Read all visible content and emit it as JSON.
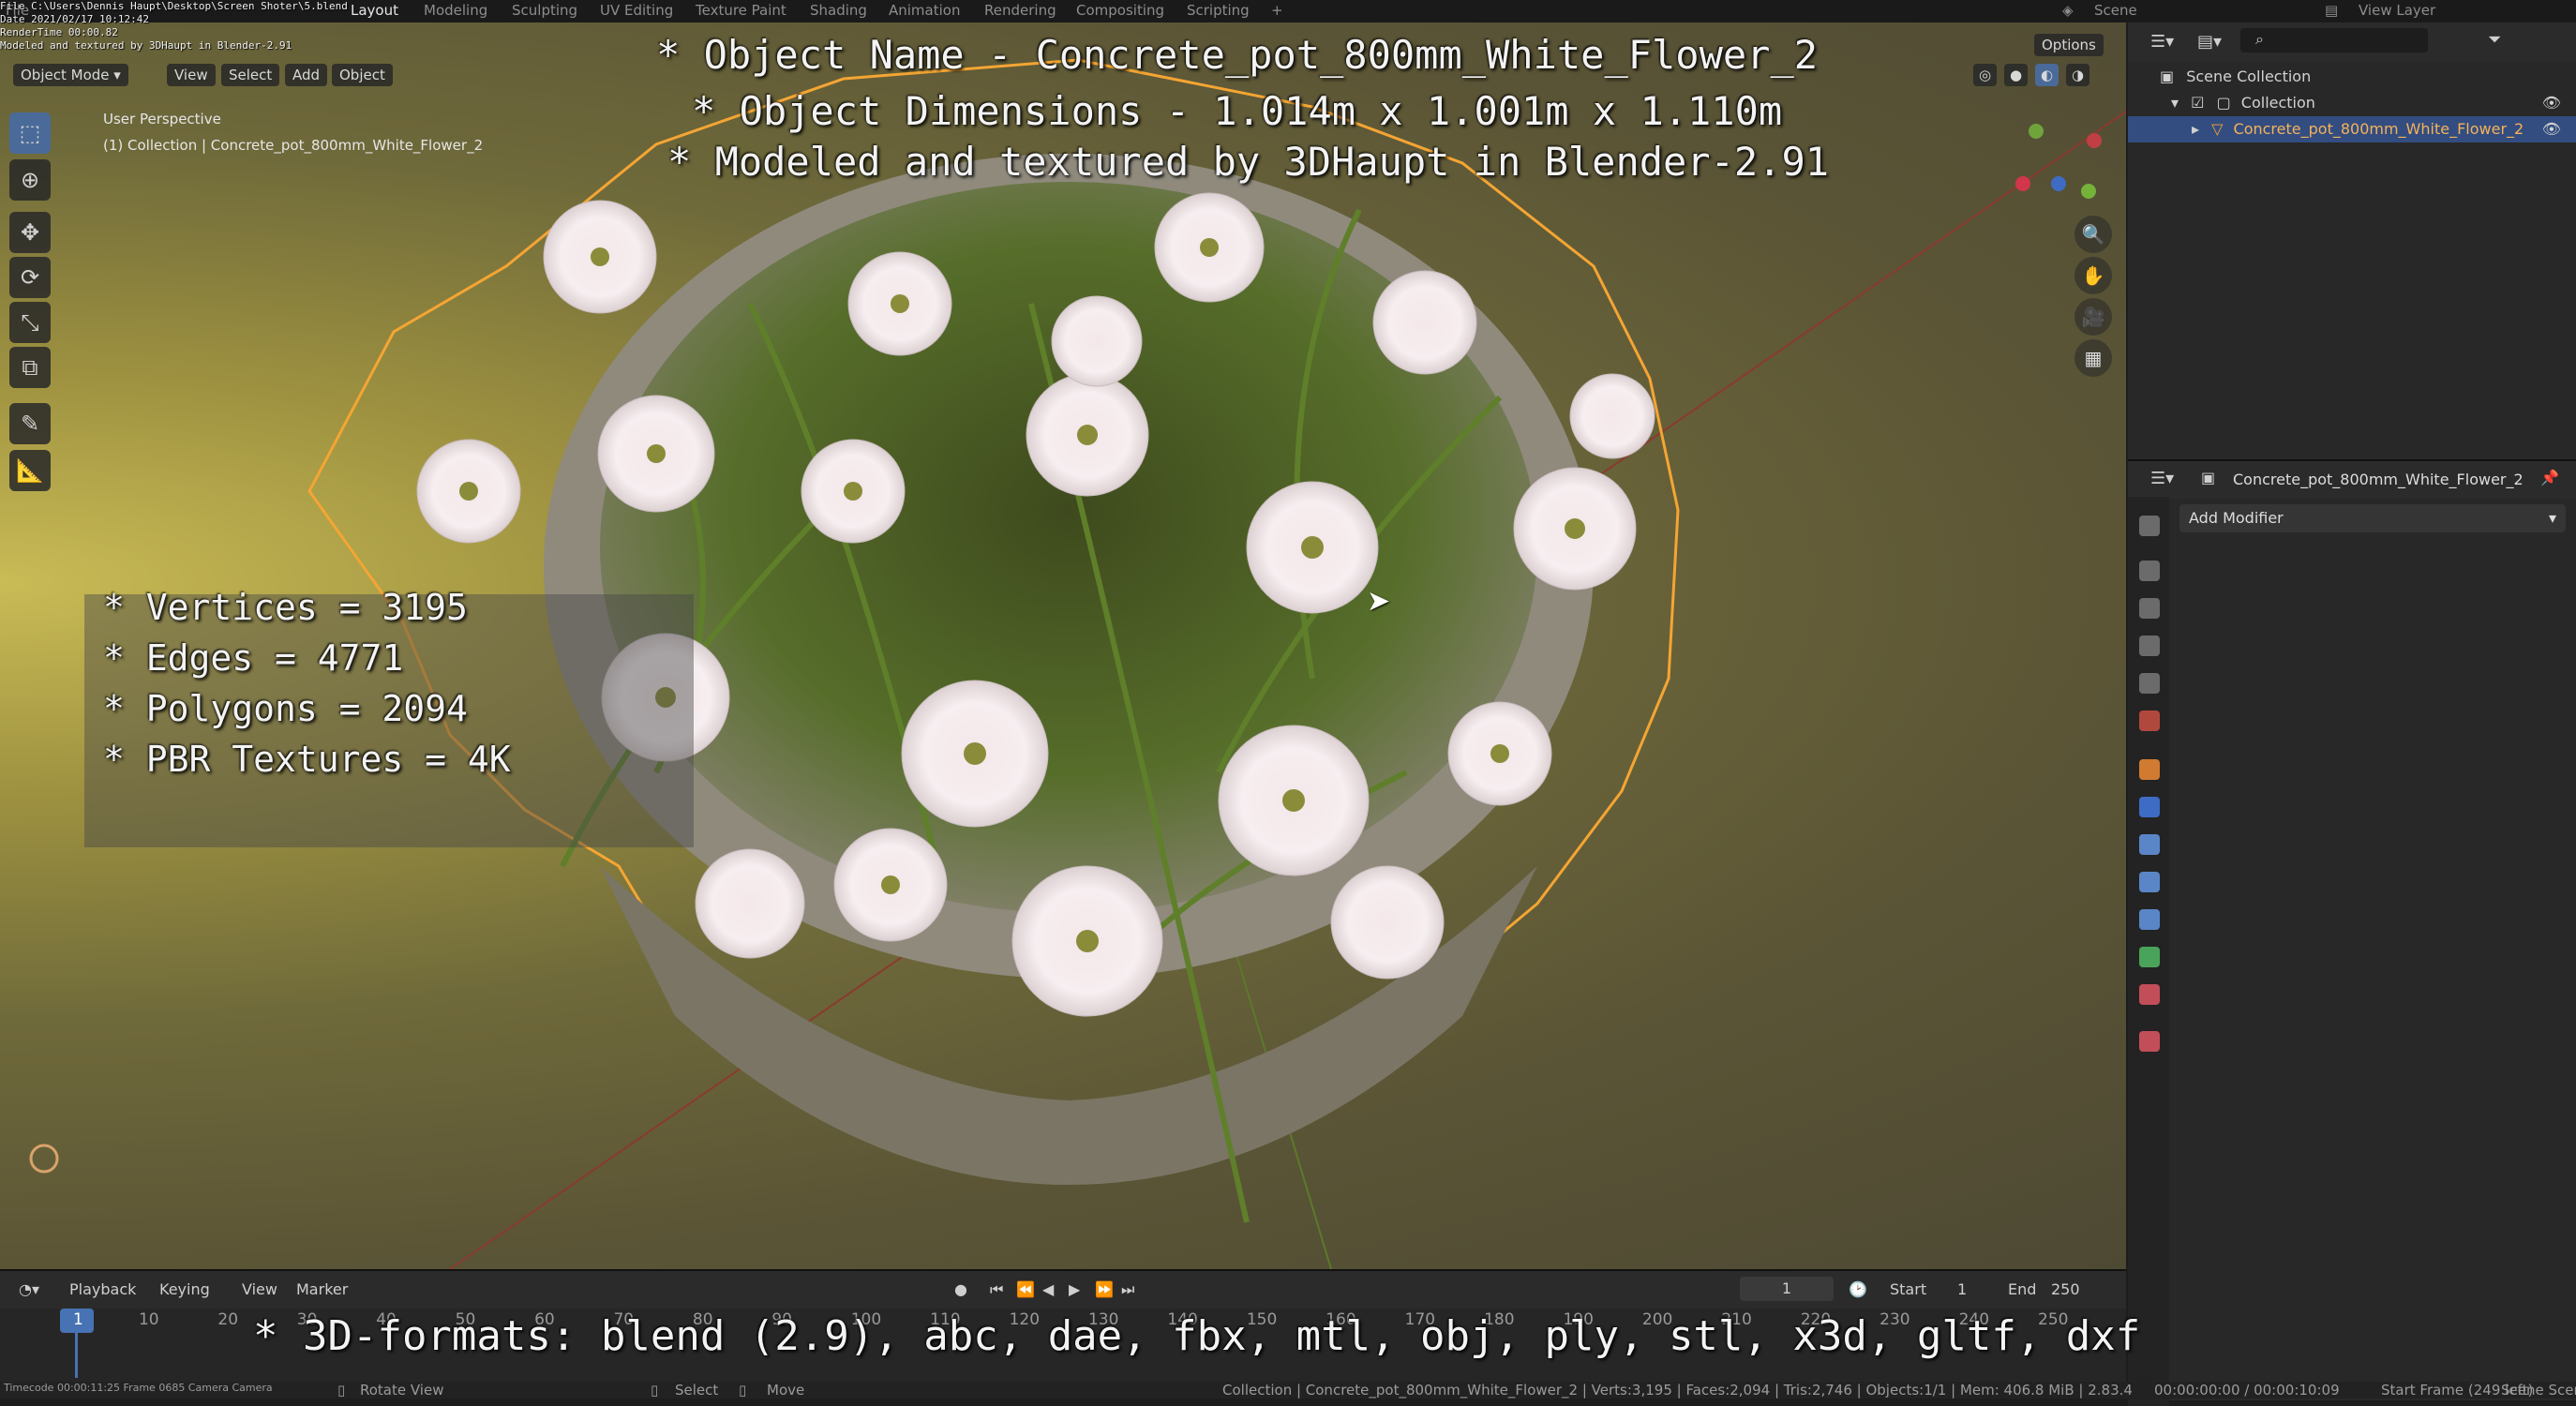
{
  "topbar": {
    "menu": "File",
    "workspaces": [
      "Layout",
      "Modeling",
      "Sculpting",
      "UV Editing",
      "Texture Paint",
      "Shading",
      "Animation",
      "Rendering",
      "Compositing",
      "Scripting"
    ],
    "scene_label": "Scene",
    "view_layer_label": "View Layer",
    "burnin": [
      "File C:\\Users\\Dennis Haupt\\Desktop\\Screen Shoter\\5.blend",
      "Date 2021/02/17 10:12:42",
      "RenderTime 00:00.82",
      "Modeled and textured by 3DHaupt in Blender-2.91"
    ]
  },
  "viewport": {
    "mode": "Object Mode",
    "menus": [
      "View",
      "Select",
      "Add",
      "Object"
    ],
    "perspective": "User Perspective",
    "collection_info": "(1) Collection | Concrete_pot_800mm_White_Flower_2",
    "options": "Options"
  },
  "overlay": {
    "title": "* Object Name - Concrete_pot_800mm_White_Flower_2",
    "dimensions": "* Object Dimensions -  1.014m x 1.001m x 1.110m",
    "credit": "* Modeled and textured by 3DHaupt in Blender-2.91",
    "stats": [
      "* Vertices = 3195",
      "* Edges = 4771",
      "* Polygons = 2094",
      "* PBR Textures = 4K"
    ],
    "formats": "* 3D-formats: blend (2.9), abc, dae, fbx, mtl, obj, ply, stl, x3d, gltf, dxf"
  },
  "outliner": {
    "scene_collection": "Scene Collection",
    "collection": "Collection",
    "object": "Concrete_pot_800mm_White_Flower_2"
  },
  "properties": {
    "object_name": "Concrete_pot_800mm_White_Flower_2",
    "add_modifier": "Add Modifier"
  },
  "timeline": {
    "menus": [
      "Playback",
      "Keying",
      "View",
      "Marker"
    ],
    "current_frame": "1",
    "start_label": "Start",
    "start": "1",
    "end_label": "End",
    "end": "250",
    "ticks": [
      "1",
      "10",
      "20",
      "30",
      "40",
      "50",
      "60",
      "70",
      "80",
      "90",
      "100",
      "110",
      "120",
      "130",
      "140",
      "150",
      "160",
      "170",
      "180",
      "190",
      "200",
      "210",
      "220",
      "230",
      "240",
      "250"
    ]
  },
  "statusbar": {
    "left": "Timecode 00:00:11:25  Frame 0685  Camera Camera",
    "rotate": "Rotate View",
    "select": "Select",
    "move": "Move",
    "info": "Collection | Concrete_pot_800mm_White_Flower_2 | Verts:3,195 | Faces:2,094 | Tris:2,746 | Objects:1/1 | Mem: 406.8 MiB | 2.83.4",
    "time": "00:00:00:00 / 00:00:10:09",
    "start_frame": "Start Frame (249 left)",
    "scene": "Scene Scene"
  },
  "colors": {
    "accent": "#4772b3",
    "selection": "#f5a533",
    "viewport_bg": "#6f6a3a"
  }
}
